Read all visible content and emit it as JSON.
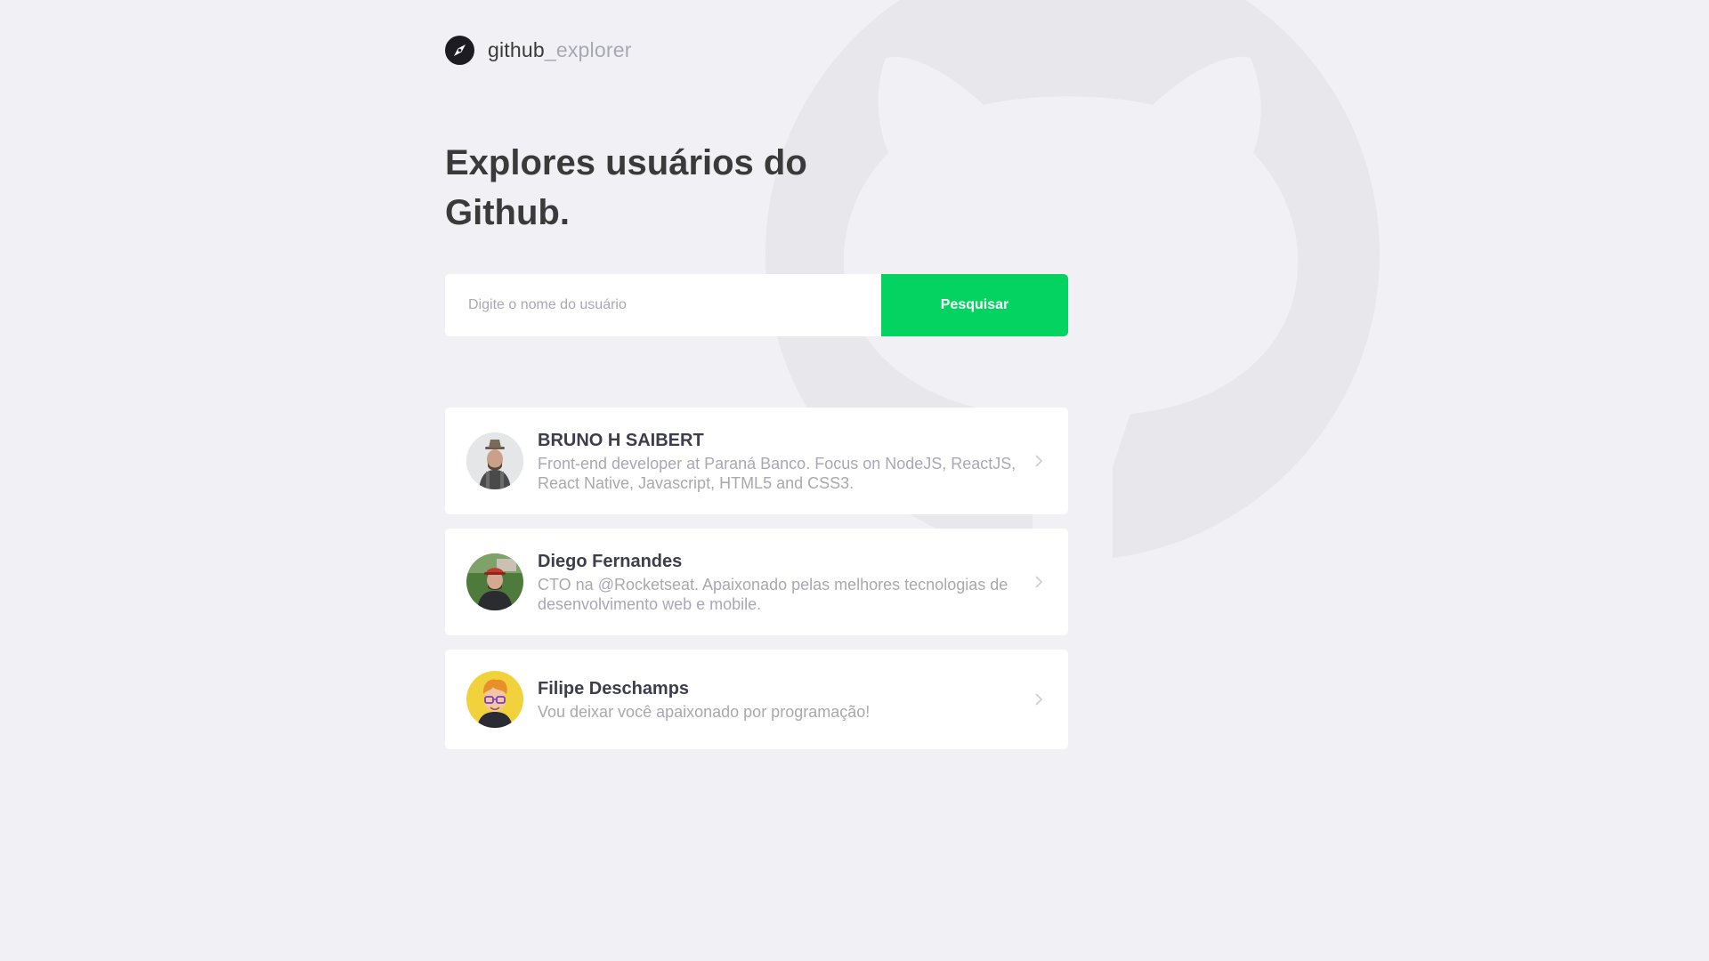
{
  "header": {
    "logo_primary": "github",
    "logo_secondary": "_explorer",
    "logo_icon": "compass-icon"
  },
  "hero": {
    "title_line1": "Explores usuários do",
    "title_line2": "Github."
  },
  "search": {
    "placeholder": "Digite o nome do usuário",
    "value": "",
    "button_label": "Pesquisar"
  },
  "users": [
    {
      "name": "BRUNO H SAIBERT",
      "description": "Front-end developer at Paraná Banco. Focus on NodeJS, ReactJS, React Native, Javascript, HTML5 and CSS3.",
      "avatar": "avatar-photo"
    },
    {
      "name": "Diego Fernandes",
      "description": "CTO na @Rocketseat. Apaixonado pelas melhores tecnologias de desenvolvimento web e mobile.",
      "avatar": "avatar-photo"
    },
    {
      "name": "Filipe Deschamps",
      "description": "Vou deixar você apaixonado por programação!",
      "avatar": "avatar-cartoon"
    }
  ],
  "colors": {
    "background": "#f0f0f5",
    "accent": "#04d361",
    "title": "#3a3a3a",
    "muted": "#a8a8b3"
  }
}
